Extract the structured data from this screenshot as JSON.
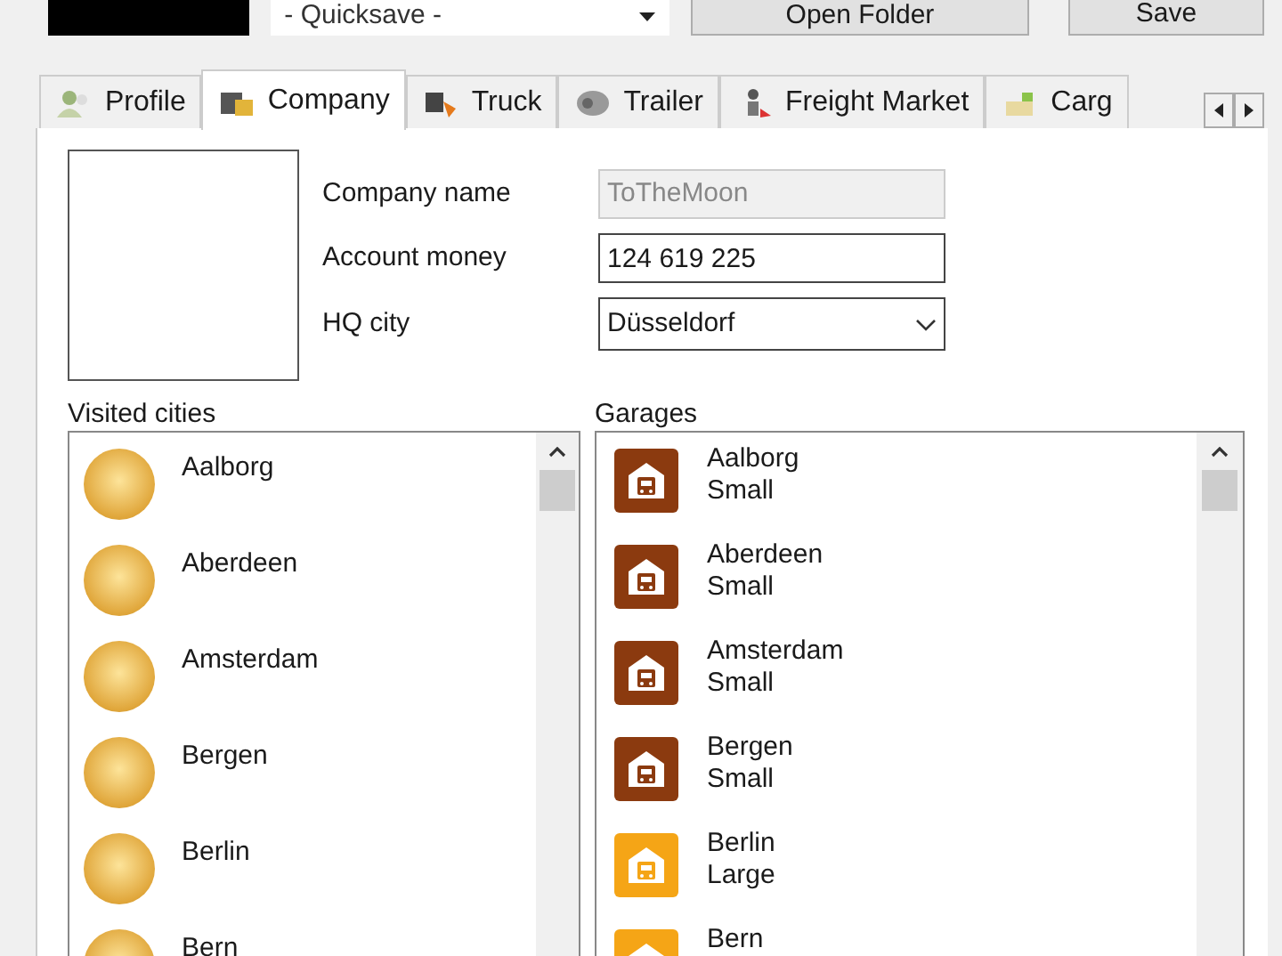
{
  "toolbar": {
    "save_selector": "- Quicksave -",
    "buttons": [
      "Open Folder",
      "Save"
    ]
  },
  "tabs": [
    {
      "label": "Profile",
      "selected": false
    },
    {
      "label": "Company",
      "selected": true
    },
    {
      "label": "Truck",
      "selected": false
    },
    {
      "label": "Trailer",
      "selected": false
    },
    {
      "label": "Freight Market",
      "selected": false
    },
    {
      "label": "Carg",
      "selected": false
    }
  ],
  "company": {
    "fields": [
      {
        "label": "Company name",
        "value": "ToTheMoon",
        "kind": "readonly"
      },
      {
        "label": "Account money",
        "value": "124 619 225",
        "kind": "text"
      },
      {
        "label": "HQ city",
        "value": "Düsseldorf",
        "kind": "dropdown"
      }
    ]
  },
  "visited_cities": {
    "title": "Visited cities",
    "items": [
      "Aalborg",
      "Aberdeen",
      "Amsterdam",
      "Bergen",
      "Berlin",
      "Bern"
    ]
  },
  "garages": {
    "title": "Garages",
    "items": [
      {
        "city": "Aalborg",
        "size": "Small",
        "color": "#8b3a0f"
      },
      {
        "city": "Aberdeen",
        "size": "Small",
        "color": "#8b3a0f"
      },
      {
        "city": "Amsterdam",
        "size": "Small",
        "color": "#8b3a0f"
      },
      {
        "city": "Bergen",
        "size": "Small",
        "color": "#8b3a0f"
      },
      {
        "city": "Berlin",
        "size": "Large",
        "color": "#f5a516"
      },
      {
        "city": "Bern",
        "color": "#f5a516"
      }
    ]
  }
}
